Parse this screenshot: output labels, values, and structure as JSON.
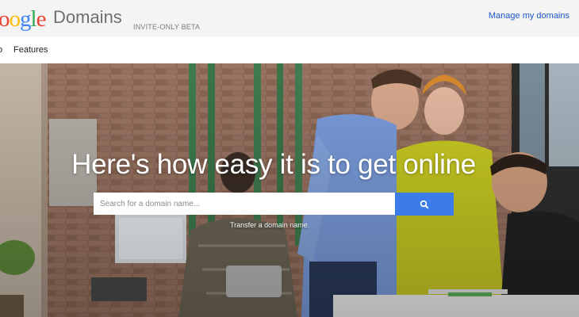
{
  "header": {
    "logo_text": "oogle",
    "logo_letters": [
      {
        "char": "o",
        "color": "#ea4335"
      },
      {
        "char": "o",
        "color": "#fbbc05"
      },
      {
        "char": "g",
        "color": "#4285f4"
      },
      {
        "char": "l",
        "color": "#34a853"
      },
      {
        "char": "e",
        "color": "#ea4335"
      }
    ],
    "product_name": "Domains",
    "beta_label": "INVITE-ONLY BETA",
    "manage_link": "Manage my domains"
  },
  "nav": {
    "items": [
      {
        "label": "o"
      },
      {
        "label": "Features"
      }
    ]
  },
  "hero": {
    "headline": "Here's how easy it is to get online",
    "search": {
      "placeholder": "Search for a domain name...",
      "value": "",
      "button_icon": "search-icon"
    },
    "transfer_link": "Transfer a domain name."
  },
  "colors": {
    "accent": "#3b7cea",
    "link": "#1a55c9",
    "header_bg": "#f4f4f4"
  }
}
